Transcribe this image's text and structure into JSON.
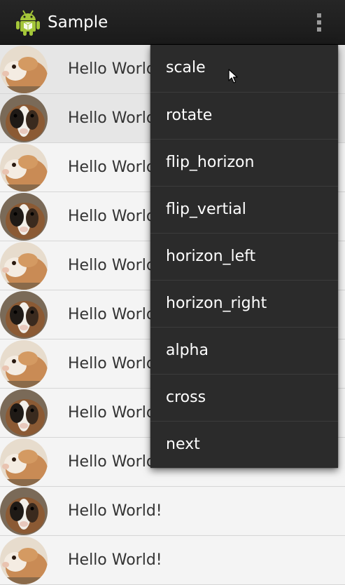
{
  "action_bar": {
    "title": "Sample",
    "app_icon": "android-robot-icon",
    "overflow_icon": "overflow-menu-icon"
  },
  "list": {
    "items": [
      {
        "text": "Hello World!",
        "avatar": "guinea-pig-orange"
      },
      {
        "text": "Hello World!",
        "avatar": "guinea-pig-bw"
      },
      {
        "text": "Hello World!",
        "avatar": "guinea-pig-orange"
      },
      {
        "text": "Hello World!",
        "avatar": "guinea-pig-bw"
      },
      {
        "text": "Hello World!",
        "avatar": "guinea-pig-orange"
      },
      {
        "text": "Hello World!",
        "avatar": "guinea-pig-bw"
      },
      {
        "text": "Hello World!",
        "avatar": "guinea-pig-orange"
      },
      {
        "text": "Hello World!",
        "avatar": "guinea-pig-bw"
      },
      {
        "text": "Hello World!",
        "avatar": "guinea-pig-orange"
      },
      {
        "text": "Hello World!",
        "avatar": "guinea-pig-bw"
      },
      {
        "text": "Hello World!",
        "avatar": "guinea-pig-orange"
      }
    ]
  },
  "overflow_menu": {
    "items": [
      {
        "label": "scale"
      },
      {
        "label": "rotate"
      },
      {
        "label": "flip_horizon"
      },
      {
        "label": "flip_vertial"
      },
      {
        "label": "horizon_left"
      },
      {
        "label": "horizon_right"
      },
      {
        "label": "alpha"
      },
      {
        "label": "cross"
      },
      {
        "label": "next"
      }
    ]
  },
  "colors": {
    "action_bar": "#1f1f1f",
    "menu_background": "#2b2b2b",
    "list_background": "#f4f4f4",
    "android_green": "#a4c639"
  }
}
